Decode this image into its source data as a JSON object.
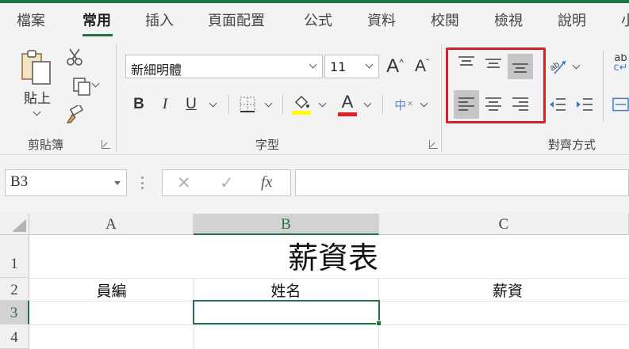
{
  "ribbon_tabs": [
    "檔案",
    "常用",
    "插入",
    "頁面配置",
    "公式",
    "資料",
    "校閱",
    "檢視",
    "說明",
    "小"
  ],
  "clipboard": {
    "paste_label": "貼上",
    "group_label": "剪貼簿"
  },
  "font": {
    "font_name": "新細明體",
    "font_size": "11",
    "bold": "B",
    "italic": "I",
    "underline": "U",
    "font_color_glyph": "A",
    "grow_glyph": "A",
    "shrink_glyph": "A",
    "phonetic_glyph": "中",
    "group_label": "字型",
    "fill_color": "#ffff00",
    "font_color": "#e0202a"
  },
  "alignment": {
    "group_label": "對齊方式",
    "wrap_glyph": "ab",
    "highlight_color": "#d0262b"
  },
  "formula_bar": {
    "name_box": "B3",
    "fx_label": "fx",
    "formula": ""
  },
  "sheet": {
    "columns": [
      "A",
      "B",
      "C"
    ],
    "rows": [
      "1",
      "2",
      "3",
      "4"
    ],
    "title": "薪資表",
    "headers": [
      "員編",
      "姓名",
      "薪資"
    ],
    "active_cell": "B3"
  }
}
